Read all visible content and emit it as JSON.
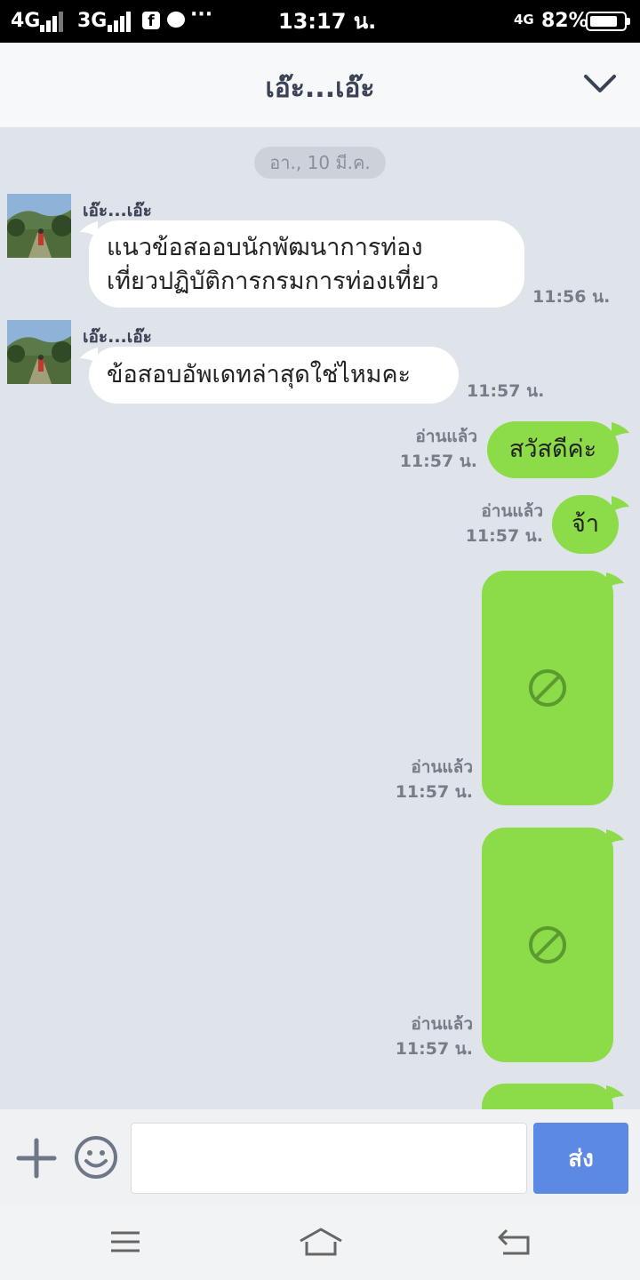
{
  "status_bar": {
    "net1": "4G",
    "net2": "3G",
    "facebook_glyph": "f",
    "more": "···",
    "time": "13:17 น.",
    "net3": "4G",
    "battery": "82%",
    "battery_level": 0.82
  },
  "header": {
    "title": "เอ๊ะ...เอ๊ะ",
    "collapse_icon": "chevron-down-icon"
  },
  "chat": {
    "date": "อา., 10 มี.ค.",
    "incoming": [
      {
        "sender": "เอ๊ะ...เอ๊ะ",
        "lines": [
          "แนวข้อสออบนักพัฒนาการท่อง",
          "เที่ยวปฏิบัติการกรมการท่องเที่ยว"
        ],
        "time": "11:56 น."
      },
      {
        "sender": "เอ๊ะ...เอ๊ะ",
        "lines": [
          "ข้อสอบอัพเดทล่าสุดใช่ไหมคะ"
        ],
        "time": "11:57 น."
      }
    ],
    "outgoing": [
      {
        "text": "สวัสดีค่ะ",
        "read": "อ่านแล้ว",
        "time": "11:57 น."
      },
      {
        "text": "จ้า",
        "read": "อ่านแล้ว",
        "time": "11:57 น."
      },
      {
        "read": "อ่านแล้ว",
        "time": "11:57 น.",
        "icon": "blocked-icon"
      },
      {
        "read": "อ่านแล้ว",
        "time": "11:57 น.",
        "icon": "blocked-icon"
      }
    ]
  },
  "input_bar": {
    "plus_icon": "plus-icon",
    "emoji_icon": "smiley-icon",
    "input_value": "",
    "send_label": "ส่ง"
  },
  "nav_bar": {
    "icons": [
      "menu-icon",
      "home-icon",
      "back-icon"
    ]
  },
  "colors": {
    "chat_bg": "#dfe3ea",
    "outgoing_bubble": "#8cdb48",
    "incoming_bubble": "#ffffff",
    "send_button": "#5b89e4",
    "header_text": "#3b4255"
  }
}
